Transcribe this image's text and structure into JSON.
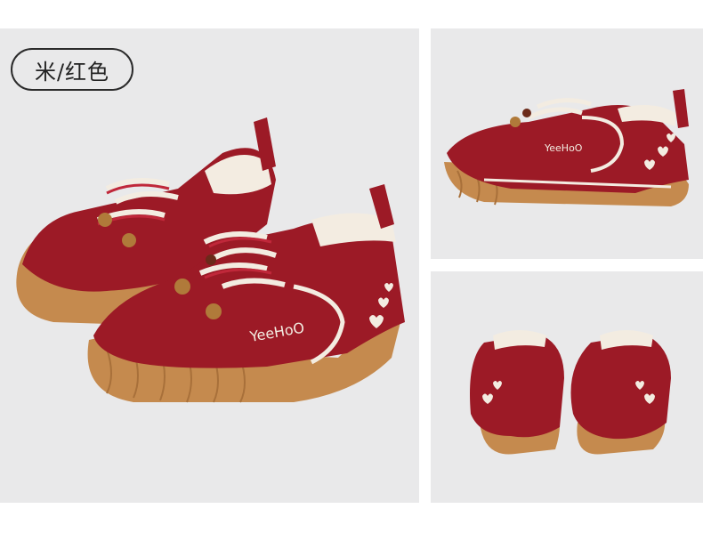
{
  "variant_label": "米/红色",
  "brand_text": "YeeHoO",
  "colors": {
    "background": "#e9e9ea",
    "upper_red": "#9c1a26",
    "sole_tan": "#c58a4e",
    "lining_cream": "#f3ece1"
  }
}
